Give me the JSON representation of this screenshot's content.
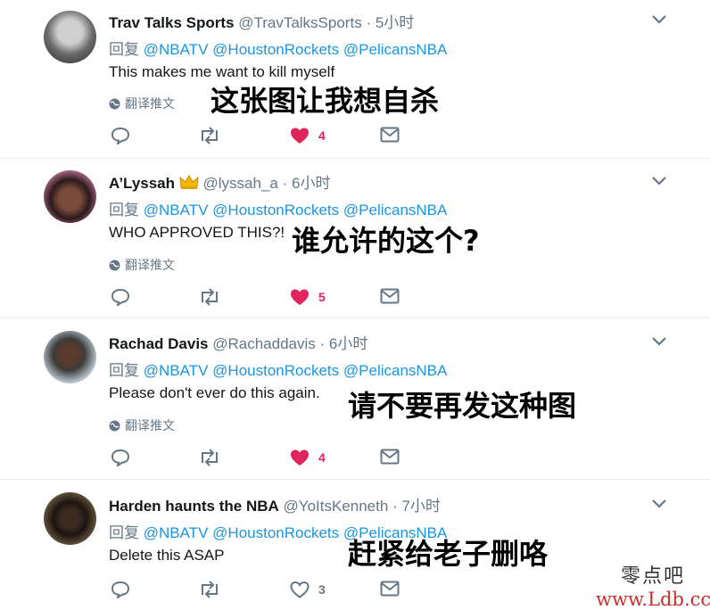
{
  "reply_prefix": "回复",
  "mentions": [
    "@NBATV",
    "@HoustonRockets",
    "@PelicansNBA"
  ],
  "translate_label": "翻译推文",
  "tweets": [
    {
      "name": "Trav Talks Sports",
      "handle": "@TravTalksSports",
      "time": "5小时",
      "text": "This makes me want to kill myself",
      "caption_cn": "这张图让我想自杀",
      "likes": "4",
      "liked": true
    },
    {
      "name": "A’Lyssah",
      "badge": "crown-emoji",
      "handle": "@lyssah_a",
      "time": "6小时",
      "text": "WHO APPROVED THIS?!",
      "caption_cn": "谁允许的这个?",
      "likes": "5",
      "liked": true
    },
    {
      "name": "Rachad Davis",
      "handle": "@Rachaddavis",
      "time": "6小时",
      "text": "Please don't ever do this again.",
      "caption_cn": "请不要再发这种图",
      "likes": "4",
      "liked": true
    },
    {
      "name": "Harden haunts the NBA",
      "handle": "@YoItsKenneth",
      "time": "7小时",
      "text": "Delete this ASAP",
      "caption_cn": "赶紧给老子删咯",
      "likes": "3",
      "liked": false
    }
  ],
  "watermark": {
    "cn": "零点吧",
    "url": "www.Ldb.cc"
  },
  "colors": {
    "link": "#1b95e0",
    "muted": "#657786",
    "like": "#e0245e",
    "divider": "#e6ecf0"
  }
}
